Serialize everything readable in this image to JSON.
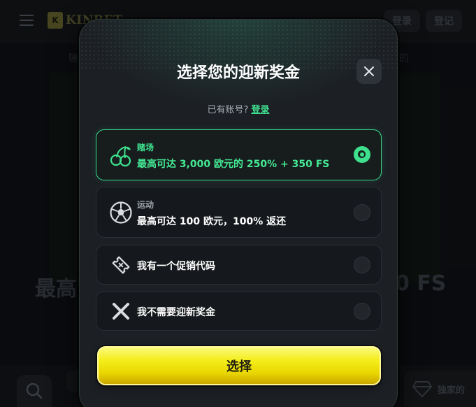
{
  "background": {
    "brand": "KINBET",
    "header": {
      "login_label": "登录",
      "register_label": "登记"
    },
    "subtitle_right_fragment": "的",
    "headline_left_fragment": "最高",
    "headline_right_fragment": "0 FS",
    "exclusive_label": "独家的"
  },
  "modal": {
    "title": "选择您的迎新奖金",
    "close_icon": "close-icon",
    "account_prompt": "已有账号?",
    "login_link": "登录",
    "options": [
      {
        "icon": "cherry-icon",
        "category": "赌场",
        "description": "最高可达 3,000 欧元的 250% + 350 FS",
        "selected": true
      },
      {
        "icon": "soccer-ball-icon",
        "category": "运动",
        "description": "最高可达 100 欧元，100% 返还",
        "selected": false
      },
      {
        "icon": "ticket-icon",
        "category": "",
        "description": "我有一个促销代码",
        "selected": false
      },
      {
        "icon": "x-icon",
        "category": "",
        "description": "我不需要迎新奖金",
        "selected": false
      }
    ],
    "submit_label": "选择"
  },
  "colors": {
    "accent_green": "#3ee08e",
    "button_yellow": "#f4ee1b",
    "modal_bg": "#1c1f24",
    "page_bg": "#0d0f12"
  }
}
